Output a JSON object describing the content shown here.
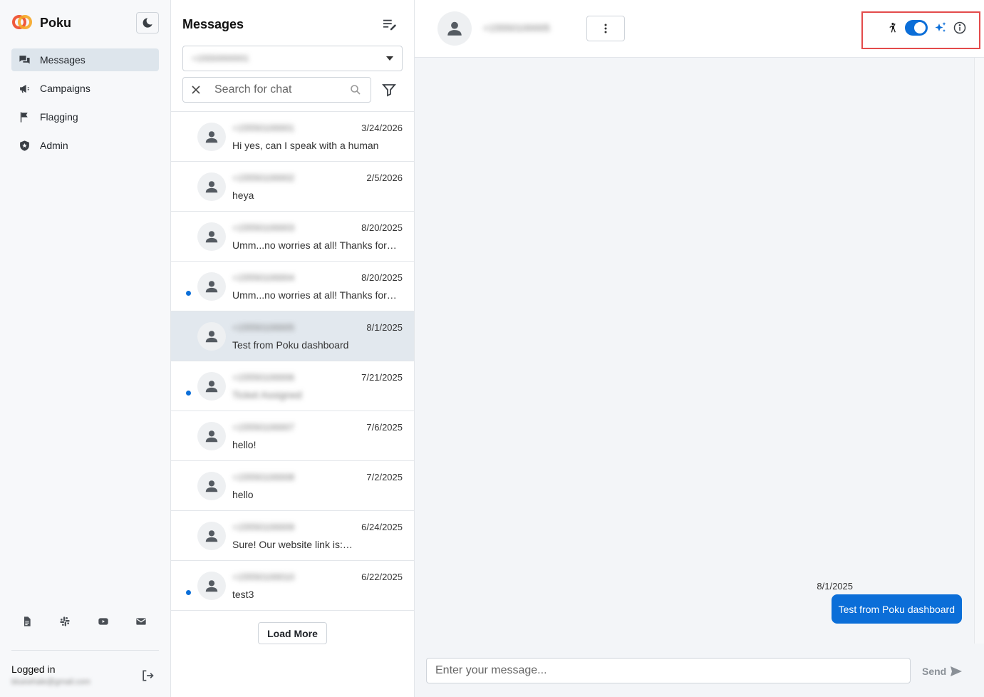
{
  "app": {
    "name": "Poku"
  },
  "sidebar": {
    "items": [
      {
        "label": "Messages",
        "icon": "chat-bubbles-icon",
        "active": true
      },
      {
        "label": "Campaigns",
        "icon": "megaphone-icon",
        "active": false
      },
      {
        "label": "Flagging",
        "icon": "flag-icon",
        "active": false
      },
      {
        "label": "Admin",
        "icon": "shield-icon",
        "active": false
      }
    ],
    "footer_icons": [
      "document-icon",
      "slack-icon",
      "youtube-icon",
      "mail-icon"
    ],
    "logged_in_label": "Logged in",
    "logged_in_user": "bluewhale@gmail.com"
  },
  "list": {
    "title": "Messages",
    "account_value": "+15550000001",
    "search_placeholder": "Search for chat",
    "conversations": [
      {
        "phone": "+15550100001",
        "date": "3/24/2026",
        "preview": "Hi yes, can I speak with a human",
        "unread": false,
        "selected": false,
        "preview_blurred": false
      },
      {
        "phone": "+15550100002",
        "date": "2/5/2026",
        "preview": "heya",
        "unread": false,
        "selected": false,
        "preview_blurred": false
      },
      {
        "phone": "+15550100003",
        "date": "8/20/2025",
        "preview": "Umm...no worries at all! Thanks for…",
        "unread": false,
        "selected": false,
        "preview_blurred": false
      },
      {
        "phone": "+15550100004",
        "date": "8/20/2025",
        "preview": "Umm...no worries at all! Thanks for…",
        "unread": true,
        "selected": false,
        "preview_blurred": false
      },
      {
        "phone": "+15550100005",
        "date": "8/1/2025",
        "preview": "Test from Poku dashboard",
        "unread": false,
        "selected": true,
        "preview_blurred": false
      },
      {
        "phone": "+15550100006",
        "date": "7/21/2025",
        "preview": "Ticket Assigned",
        "unread": true,
        "selected": false,
        "preview_blurred": true
      },
      {
        "phone": "+15550100007",
        "date": "7/6/2025",
        "preview": "hello!",
        "unread": false,
        "selected": false,
        "preview_blurred": false
      },
      {
        "phone": "+15550100008",
        "date": "7/2/2025",
        "preview": "hello",
        "unread": false,
        "selected": false,
        "preview_blurred": false
      },
      {
        "phone": "+15550100009",
        "date": "6/24/2025",
        "preview": "Sure! Our website link is:…",
        "unread": false,
        "selected": false,
        "preview_blurred": false
      },
      {
        "phone": "+15550100010",
        "date": "6/22/2025",
        "preview": "test3",
        "unread": true,
        "selected": false,
        "preview_blurred": false
      }
    ],
    "load_more_label": "Load More"
  },
  "chat": {
    "contact": "+15550100005",
    "ai_toggle_on": true,
    "accent_color": "#0b6ed8",
    "highlight_color": "#e34b4b",
    "messages": [
      {
        "date": "8/1/2025",
        "text": "Test from Poku dashboard",
        "direction": "outgoing"
      }
    ],
    "composer_placeholder": "Enter your message...",
    "send_label": "Send"
  }
}
